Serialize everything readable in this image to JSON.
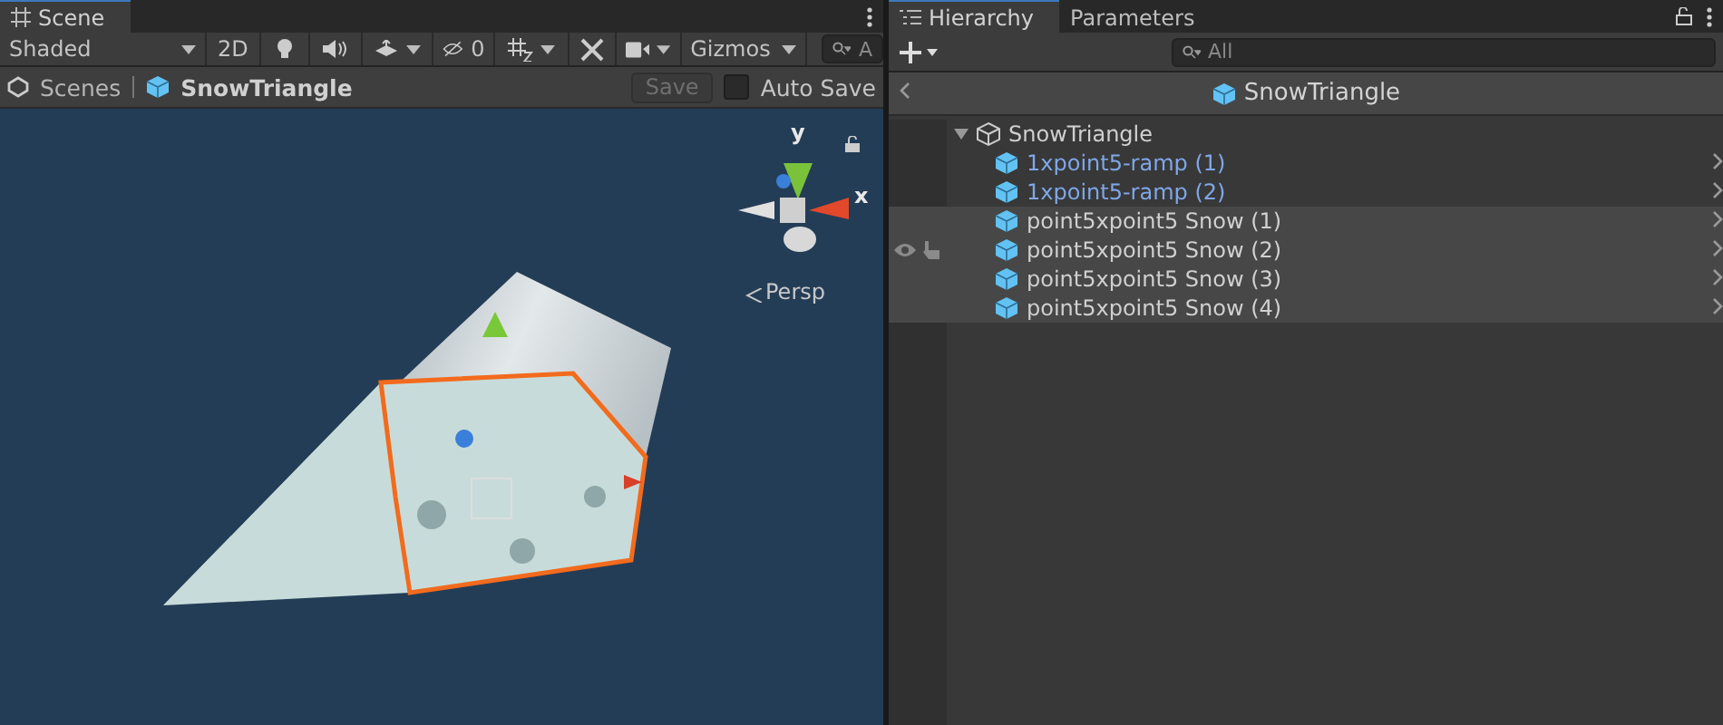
{
  "scene_panel": {
    "tab": {
      "label": "Scene",
      "selected": true
    },
    "toolbar": {
      "shading": "Shaded",
      "mode_2d": "2D",
      "hidden_count": "0",
      "gizmos": "Gizmos",
      "search_placeholder": "A"
    },
    "breadcrumb": {
      "root": "Scenes",
      "current": "SnowTriangle",
      "save": "Save",
      "auto_save": {
        "label": "Auto Save",
        "checked": false
      }
    },
    "viewport": {
      "axis_y": "y",
      "axis_x": "x",
      "projection": "Persp"
    }
  },
  "hierarchy_panel": {
    "tabs": [
      {
        "label": "Hierarchy",
        "selected": true
      },
      {
        "label": "Parameters",
        "selected": false
      }
    ],
    "search_placeholder": "All",
    "header": "SnowTriangle",
    "root": {
      "label": "SnowTriangle",
      "expanded": true,
      "children": [
        {
          "label": "1xpoint5-ramp (1)",
          "kind": "prefab",
          "highlighted": false,
          "hovered": false
        },
        {
          "label": "1xpoint5-ramp (2)",
          "kind": "prefab",
          "highlighted": false,
          "hovered": false
        },
        {
          "label": "point5xpoint5 Snow (1)",
          "kind": "object",
          "highlighted": true,
          "hovered": false
        },
        {
          "label": "point5xpoint5 Snow (2)",
          "kind": "object",
          "highlighted": true,
          "hovered": true
        },
        {
          "label": "point5xpoint5 Snow (3)",
          "kind": "object",
          "highlighted": true,
          "hovered": false
        },
        {
          "label": "point5xpoint5 Snow (4)",
          "kind": "object",
          "highlighted": true,
          "hovered": false
        }
      ]
    }
  }
}
